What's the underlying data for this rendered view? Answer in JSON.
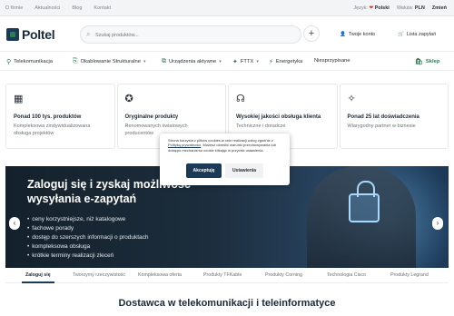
{
  "topbar": {
    "links": [
      "O firmie",
      "Aktualności",
      "Blog",
      "Kontakt"
    ],
    "language_label": "Język:",
    "language_value": "Polski",
    "currency_label": "Waluta:",
    "currency_value": "PLN",
    "account_label": "Zmień"
  },
  "header": {
    "logo_text": "Poltel",
    "search_placeholder": "Szukaj produktów...",
    "plus": "+",
    "account_label": "Twoje konto",
    "cart_label": "Lista zapytań"
  },
  "categories": [
    {
      "label": "Telekomunikacja",
      "icon": "antenna-icon"
    },
    {
      "label": "Okablowanie Strukturalne",
      "icon": "cable-icon"
    },
    {
      "label": "Urządzenia aktywne",
      "icon": "switch-icon"
    },
    {
      "label": "FTTX",
      "icon": "fiber-icon"
    },
    {
      "label": "Energetyka",
      "icon": "energy-icon"
    },
    {
      "label": "Niesprzypisane",
      "icon": ""
    }
  ],
  "shop_label": "Sklep",
  "features": [
    {
      "title": "Ponad 100 tys. produktów",
      "desc": "Kompleksowa zindywidualizowana obsługa projektów",
      "icon": "box-icon"
    },
    {
      "title": "Oryginalne produkty",
      "desc": "Renomowanych światowych producentów",
      "icon": "badge-icon"
    },
    {
      "title": "Wysokiej jakości obsługa klienta",
      "desc": "Techniczne i doradcze",
      "icon": "headset-icon"
    },
    {
      "title": "Ponad 25 lat doświadczenia",
      "desc": "Wiarygodny partner w biznesie",
      "icon": "award-icon"
    }
  ],
  "hero": {
    "title": "Zaloguj się i zyskaj możliwość wysyłania e-zapytań",
    "bullets": [
      "ceny korzystniejsze, niż katalogowe",
      "fachowe porady",
      "dostęp do szerszych informacji o produktach",
      "kompleksowa obsługa",
      "krótkie terminy realizacji zleceń"
    ],
    "prev": "‹",
    "next": "›"
  },
  "tabs": [
    "Zaloguj się",
    "Tworzymy rzeczywistość",
    "Kompleksowa oferta",
    "Produkty TFKable",
    "Produkty Corning",
    "Technologia Cisco",
    "Produkty Legrand"
  ],
  "section_title": "Dostawca w telekomunikacji i teleinformatyce",
  "cookie": {
    "text_before": "Strona korzysta z plików cookies w celu realizacji usług zgodnie z",
    "link": "Polityką prywatności",
    "text_after": ". Możesz określić warunki przechowywania lub dostępu mechanizmu cookie klikając w przycisk ustawienia.",
    "accept": "Akceptuję",
    "settings": "Ustawienia"
  },
  "colors": {
    "brand_dark": "#1b3a57",
    "brand_green": "#2e7d4f"
  }
}
